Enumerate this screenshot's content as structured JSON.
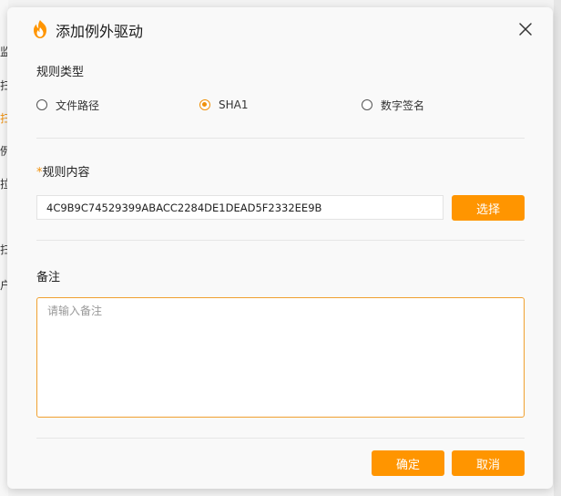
{
  "background": {
    "sidebar_fragments": [
      "监",
      "扫",
      "扫",
      "例",
      "拉",
      "扫",
      "户"
    ],
    "active_index": 2
  },
  "dialog": {
    "title": "添加例外驱动",
    "logo_icon": "flame-shield-icon",
    "close_icon": "close-icon",
    "accent_color": "#ff9500"
  },
  "rule_type": {
    "label": "规则类型",
    "options": [
      {
        "label": "文件路径",
        "checked": false
      },
      {
        "label": "SHA1",
        "checked": true
      },
      {
        "label": "数字签名",
        "checked": false
      }
    ]
  },
  "rule_content": {
    "required_mark": "*",
    "label": "规则内容",
    "value": "4C9B9C74529399ABACC2284DE1DEAD5F2332EE9B",
    "select_button": "选择"
  },
  "remark": {
    "label": "备注",
    "placeholder": "请输入备注",
    "value": ""
  },
  "footer": {
    "confirm_button": "确定",
    "cancel_button": "取消"
  }
}
